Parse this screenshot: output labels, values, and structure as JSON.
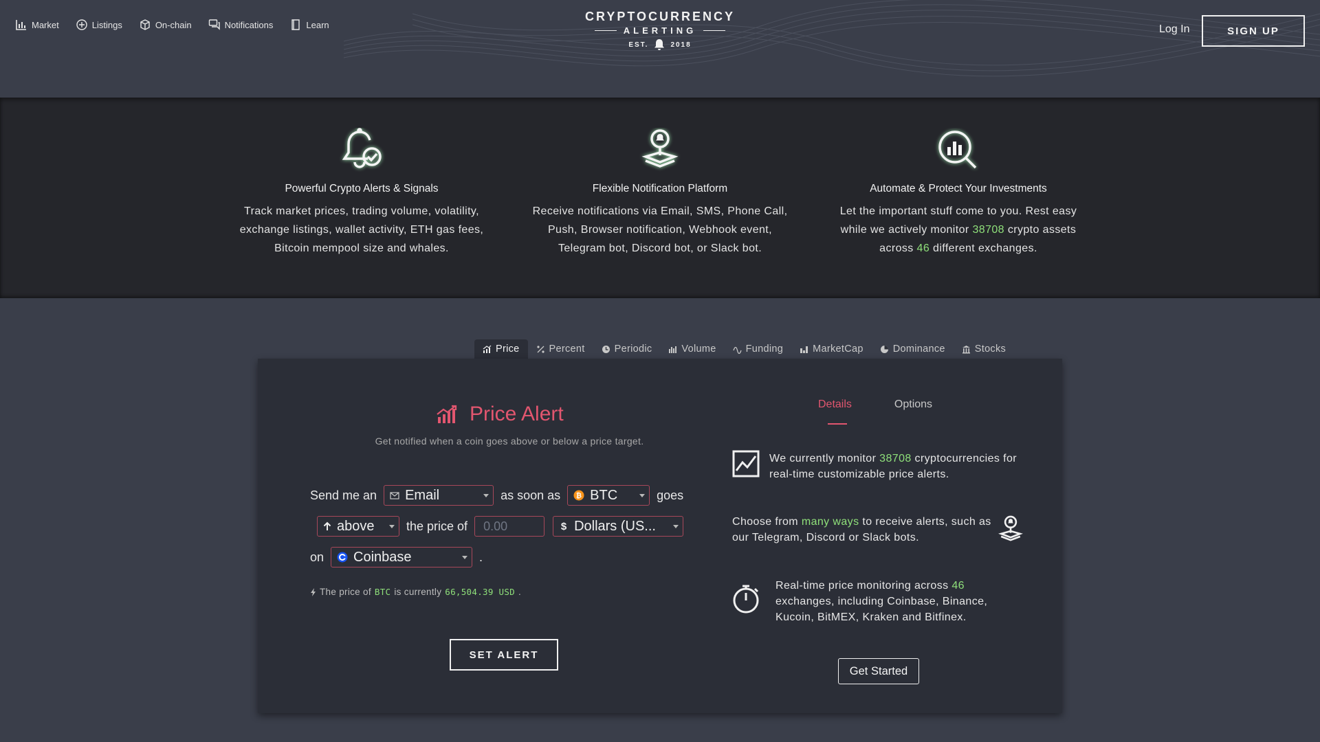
{
  "nav": {
    "items": [
      {
        "label": "Market",
        "icon": "bar-chart-icon"
      },
      {
        "label": "Listings",
        "icon": "plus-circle-icon"
      },
      {
        "label": "On-chain",
        "icon": "cube-icon"
      },
      {
        "label": "Notifications",
        "icon": "chat-bubbles-icon"
      },
      {
        "label": "Learn",
        "icon": "book-icon"
      }
    ]
  },
  "logo": {
    "line1": "CRYPTOCURRENCY",
    "line2": "ALERTING",
    "est": "EST.",
    "year": "2018"
  },
  "header": {
    "login": "Log In",
    "signup": "SIGN UP"
  },
  "features": [
    {
      "title": "Powerful Crypto Alerts & Signals",
      "text": "Track market prices, trading volume, volatility, exchange listings, wallet activity, ETH gas fees, Bitcoin mempool size and whales."
    },
    {
      "title": "Flexible Notification Platform",
      "text": "Receive notifications via Email, SMS, Phone Call, Push, Browser notification, Webhook event, Telegram bot, Discord bot, or Slack bot."
    },
    {
      "title": "Automate & Protect Your Investments",
      "text_a": "Let the important stuff come to you. Rest easy while we actively monitor",
      "assets": "38708",
      "text_b": "crypto assets across",
      "exchanges": "46",
      "text_c": "different exchanges."
    }
  ],
  "tabs": [
    "Price",
    "Percent",
    "Periodic",
    "Volume",
    "Funding",
    "MarketCap",
    "Dominance",
    "Stocks"
  ],
  "alert": {
    "title": "Price Alert",
    "subtitle": "Get notified when a coin goes above or below a price target.",
    "send_me_an": "Send me an",
    "method": "Email",
    "as_soon_as": "as soon as",
    "coin": "BTC",
    "goes": "goes",
    "direction": "above",
    "the_price_of": "the price of",
    "price_placeholder": "0.00",
    "currency": "Dollars (US...",
    "on": "on",
    "exchange": "Coinbase",
    "period": ".",
    "status_a": "The price of",
    "status_coin": "BTC",
    "status_b": "is currently",
    "status_price": "66,504.39 USD",
    "status_end": ".",
    "button": "SET ALERT"
  },
  "details": {
    "tabs": [
      "Details",
      "Options"
    ],
    "info1_a": "We currently monitor",
    "info1_num": "38708",
    "info1_b": "cryptocurrencies for real-time customizable price alerts.",
    "info2_a": "Choose from",
    "info2_link": "many ways",
    "info2_b": "to receive alerts, such as our Telegram, Discord or Slack bots.",
    "info3_a": "Real-time price monitoring across",
    "info3_num": "46",
    "info3_b": "exchanges, including Coinbase, Binance, Kucoin, BitMEX, Kraken and Bitfinex.",
    "button": "Get Started"
  },
  "colors": {
    "accent": "#e2566f",
    "highlight": "#8fe07a",
    "background": "#3a3e4a",
    "band": "#25262b",
    "panel": "#2b2e37"
  }
}
